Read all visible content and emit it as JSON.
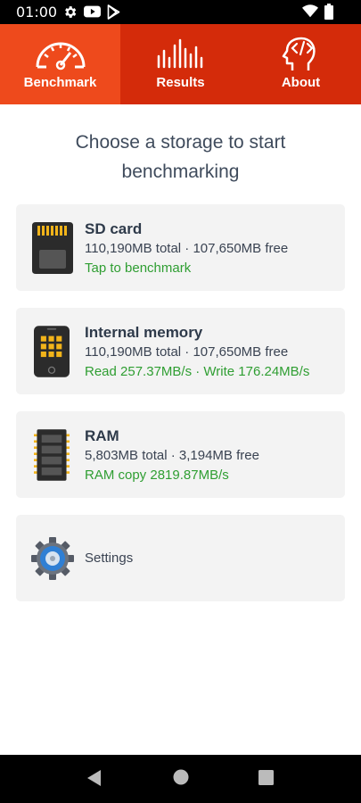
{
  "status_bar": {
    "time": "01:00",
    "left_icons": [
      "gear-icon",
      "youtube-icon",
      "play-store-icon"
    ],
    "right_icons": [
      "wifi-icon",
      "battery-icon"
    ]
  },
  "tabs": [
    {
      "label": "Benchmark",
      "icon": "speedometer-icon",
      "active": true
    },
    {
      "label": "Results",
      "icon": "bars-icon",
      "active": false
    },
    {
      "label": "About",
      "icon": "head-code-icon",
      "active": false
    }
  ],
  "heading": "Choose a storage to start benchmarking",
  "storages": [
    {
      "title": "SD card",
      "details": "110,190MB total · 107,650MB free",
      "status": "Tap to benchmark",
      "icon": "sd-card-icon"
    },
    {
      "title": "Internal memory",
      "details": "110,190MB total · 107,650MB free",
      "status": "Read 257.37MB/s · Write 176.24MB/s",
      "icon": "phone-icon"
    },
    {
      "title": "RAM",
      "details": "5,803MB total · 3,194MB free",
      "status": "RAM copy 2819.87MB/s",
      "icon": "ram-chip-icon"
    }
  ],
  "settings": {
    "label": "Settings",
    "icon": "settings-gear-icon"
  },
  "nav": [
    "back-icon",
    "home-icon",
    "recents-icon"
  ],
  "colors": {
    "tab_bar": "#d42b0a",
    "tab_active": "#ee4a1c",
    "status_green": "#2f9e32",
    "card_bg": "#f3f3f3"
  }
}
